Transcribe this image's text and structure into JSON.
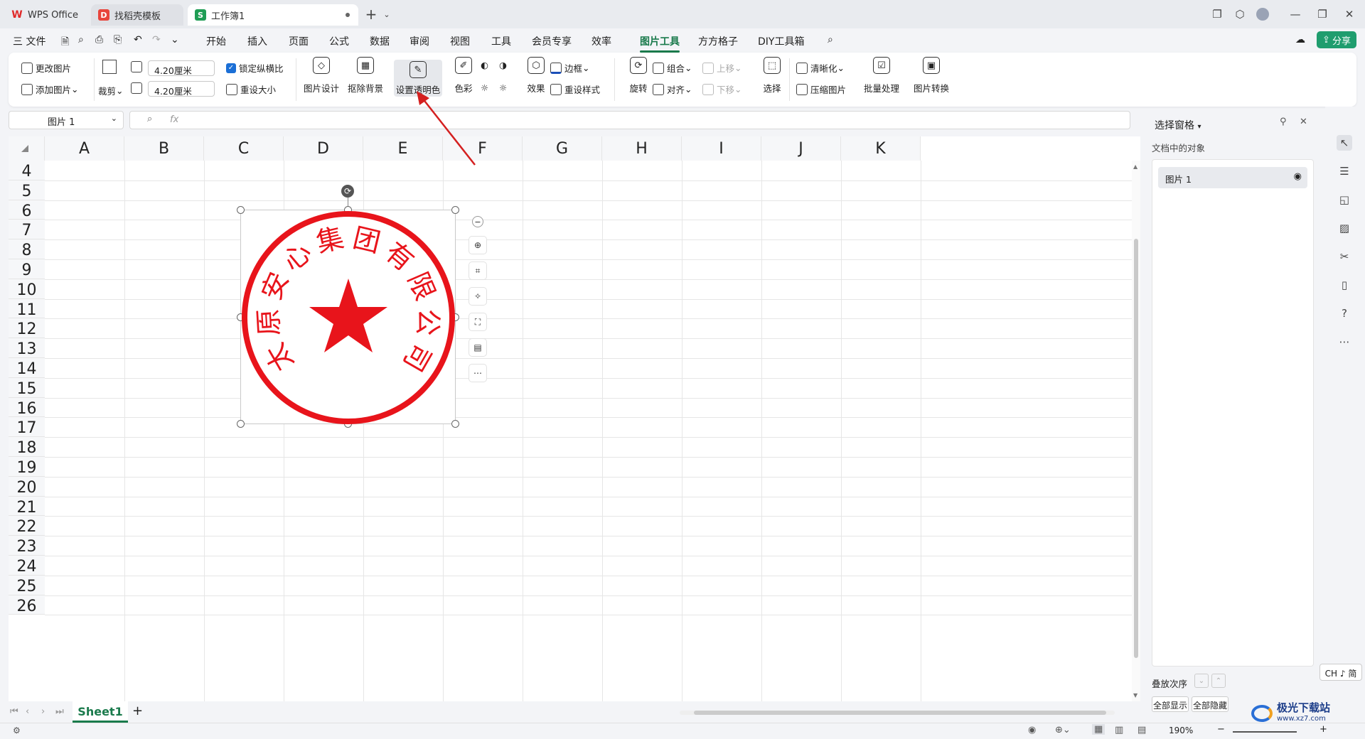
{
  "titlebar": {
    "tabs": [
      {
        "label": "WPS Office"
      },
      {
        "label": "找稻壳模板"
      },
      {
        "label": "工作簿1"
      }
    ],
    "new_tab": "+"
  },
  "menubar": {
    "file": "三 文件",
    "items": [
      "开始",
      "插入",
      "页面",
      "公式",
      "数据",
      "审阅",
      "视图",
      "工具",
      "会员专享",
      "效率",
      "图片工具",
      "方方格子",
      "DIY工具箱"
    ],
    "share": "分享"
  },
  "ribbon": {
    "change_pic": "更改图片",
    "add_pic": "添加图片",
    "crop": "裁剪",
    "width": "4.20厘米",
    "height": "4.20厘米",
    "lock_ratio": "锁定纵横比",
    "reset_size": "重设大小",
    "pic_design": "图片设计",
    "remove_bg": "抠除背景",
    "set_transparent": "设置透明色",
    "color": "色彩",
    "effect": "效果",
    "border": "边框",
    "reset_style": "重设样式",
    "rotate": "旋转",
    "group": "组合",
    "align": "对齐",
    "bring_up": "上移",
    "send_down": "下移",
    "select": "选择",
    "sharpen": "清晰化",
    "compress": "压缩图片",
    "batch": "批量处理",
    "convert": "图片转换"
  },
  "formula": {
    "name_box": "图片 1",
    "fx": "fx"
  },
  "columns": [
    "A",
    "B",
    "C",
    "D",
    "E",
    "F",
    "G",
    "H",
    "I",
    "J",
    "K"
  ],
  "rows": [
    "4",
    "5",
    "6",
    "7",
    "8",
    "9",
    "10",
    "11",
    "12",
    "13",
    "14",
    "15",
    "16",
    "17",
    "18",
    "19",
    "20",
    "21",
    "22",
    "23",
    "24",
    "25",
    "26"
  ],
  "stamp": {
    "text": [
      "太",
      "原",
      "安",
      "心",
      "集",
      "团",
      "有",
      "限",
      "公",
      "司"
    ],
    "color": "#e8141b"
  },
  "sheetbar": {
    "sheet": "Sheet1",
    "add": "+"
  },
  "pane": {
    "title": "选择窗格",
    "subtitle": "文档中的对象",
    "object": "图片 1",
    "order_label": "叠放次序",
    "show_all": "全部显示",
    "hide_all": "全部隐藏"
  },
  "statusbar": {
    "zoom": "190%"
  },
  "ime": "CH ♪ 简",
  "watermark": "极光下载站",
  "watermark_url": "www.xz7.com"
}
